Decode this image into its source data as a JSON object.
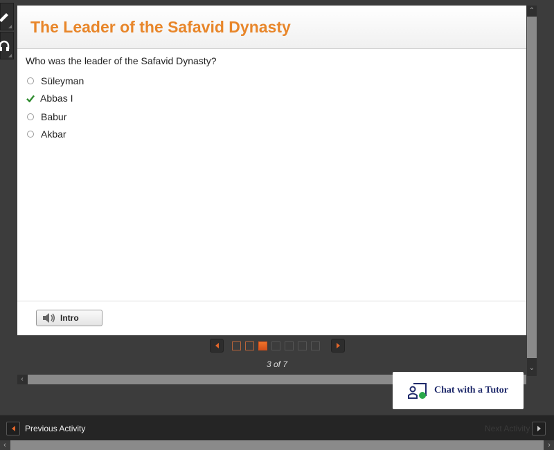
{
  "side_tools": [
    {
      "name": "pencil-tool",
      "icon": "pencil-icon"
    },
    {
      "name": "audio-tool",
      "icon": "headphones-icon"
    }
  ],
  "activity": {
    "title": "The Leader of the Safavid Dynasty",
    "question": "Who was the leader of the Safavid Dynasty?",
    "options": [
      {
        "label": "Süleyman",
        "state": "unselected"
      },
      {
        "label": "Abbas I",
        "state": "correct"
      },
      {
        "label": "Babur",
        "state": "unselected"
      },
      {
        "label": "Akbar",
        "state": "unselected"
      }
    ],
    "intro_button": "Intro"
  },
  "pager": {
    "current": 3,
    "total": 7,
    "label": "3 of 7"
  },
  "tutor": {
    "label": "Chat with a Tutor"
  },
  "bottom_nav": {
    "previous_label": "Previous Activity",
    "next_label": "Next Activity"
  },
  "colors": {
    "title": "#e8862a",
    "accent": "#e2662a",
    "check": "#2e8b2e",
    "tutor_text": "#1f2a6b",
    "tutor_dot": "#2aa84a"
  }
}
